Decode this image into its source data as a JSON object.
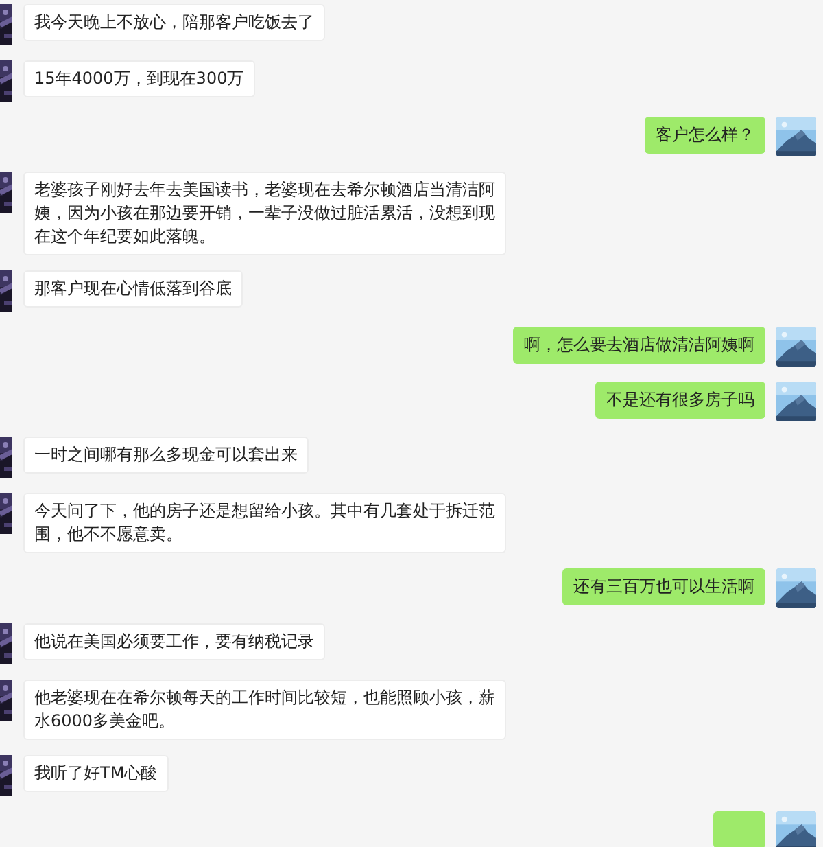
{
  "messages": [
    {
      "kind": "incoming",
      "text": "我今天晚上不放心，陪那客户吃饭去了"
    },
    {
      "kind": "incoming",
      "text": "15年4000万，到现在300万"
    },
    {
      "kind": "outgoing",
      "text": "客户怎么样？"
    },
    {
      "kind": "incoming",
      "text": "老婆孩子刚好去年去美国读书，老婆现在去希尔顿酒店当清洁阿姨，因为小孩在那边要开销，一辈子没做过脏活累活，没想到现在这个年纪要如此落魄。"
    },
    {
      "kind": "incoming",
      "text": "那客户现在心情低落到谷底"
    },
    {
      "kind": "outgoing",
      "text": "啊，怎么要去酒店做清洁阿姨啊"
    },
    {
      "kind": "outgoing",
      "text": "不是还有很多房子吗"
    },
    {
      "kind": "incoming",
      "text": "一时之间哪有那么多现金可以套出来"
    },
    {
      "kind": "incoming",
      "text": "今天问了下，他的房子还是想留给小孩。其中有几套处于拆迁范围，他不不愿意卖。"
    },
    {
      "kind": "outgoing",
      "text": "还有三百万也可以生活啊"
    },
    {
      "kind": "incoming",
      "text": "他说在美国必须要工作，要有纳税记录"
    },
    {
      "kind": "incoming",
      "text": "他老婆现在在希尔顿每天的工作时间比较短，也能照顾小孩，薪水6000多美金吧。"
    },
    {
      "kind": "incoming",
      "text": "我听了好TM心酸"
    },
    {
      "kind": "outgoing"
    }
  ]
}
